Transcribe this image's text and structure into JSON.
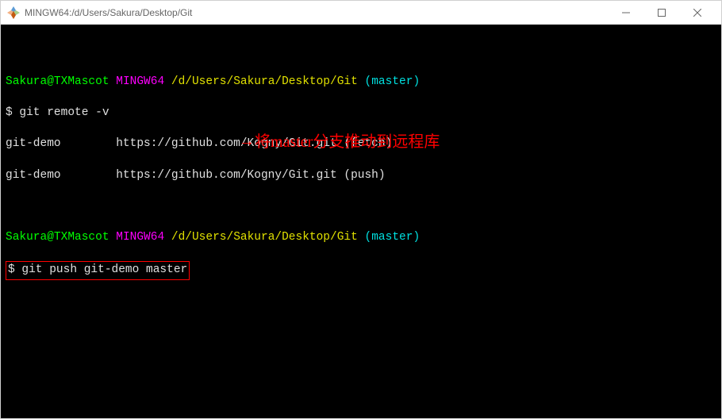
{
  "window": {
    "title": "MINGW64:/d/Users/Sakura/Desktop/Git"
  },
  "terminal": {
    "prompt1": {
      "user": "Sakura",
      "at": "@",
      "host": "TXMascot",
      "shell": "MINGW64",
      "path": "/d/Users/Sakura/Desktop/Git",
      "branch": "(master)"
    },
    "cmd1": {
      "prompt": "$ ",
      "text": "git remote -v"
    },
    "output1": "git-demo        https://github.com/Kogny/Git.git (fetch)",
    "output2": "git-demo        https://github.com/Kogny/Git.git (push)",
    "prompt2": {
      "user": "Sakura",
      "at": "@",
      "host": "TXMascot",
      "shell": "MINGW64",
      "path": "/d/Users/Sakura/Desktop/Git",
      "branch": "(master)"
    },
    "cmd2": {
      "prompt": "$ ",
      "text": "git push git-demo master"
    },
    "annotation": "将master分支推动到远程库"
  }
}
